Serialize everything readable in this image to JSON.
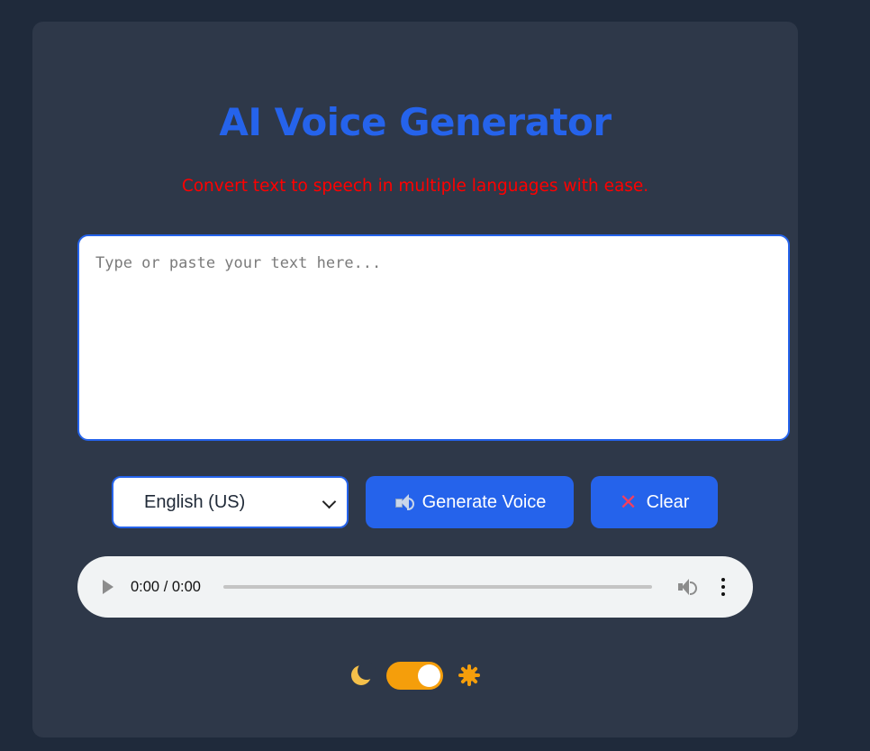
{
  "header": {
    "title": "AI Voice Generator",
    "subtitle": "Convert text to speech in multiple languages with ease."
  },
  "input": {
    "placeholder": "Type or paste your text here...",
    "value": ""
  },
  "controls": {
    "language_selected": "English (US)",
    "generate_label": "Generate Voice",
    "clear_label": "Clear"
  },
  "audio": {
    "time": "0:00 / 0:00",
    "progress": 0
  },
  "theme": {
    "moon_icon": "moon-icon",
    "sun_icon": "sun-icon",
    "toggle_on": true
  },
  "colors": {
    "background": "#1f2a3b",
    "card": "#2e3849",
    "accent": "#2563eb",
    "subtitle": "#ff0000",
    "toggle": "#f59e0b"
  }
}
